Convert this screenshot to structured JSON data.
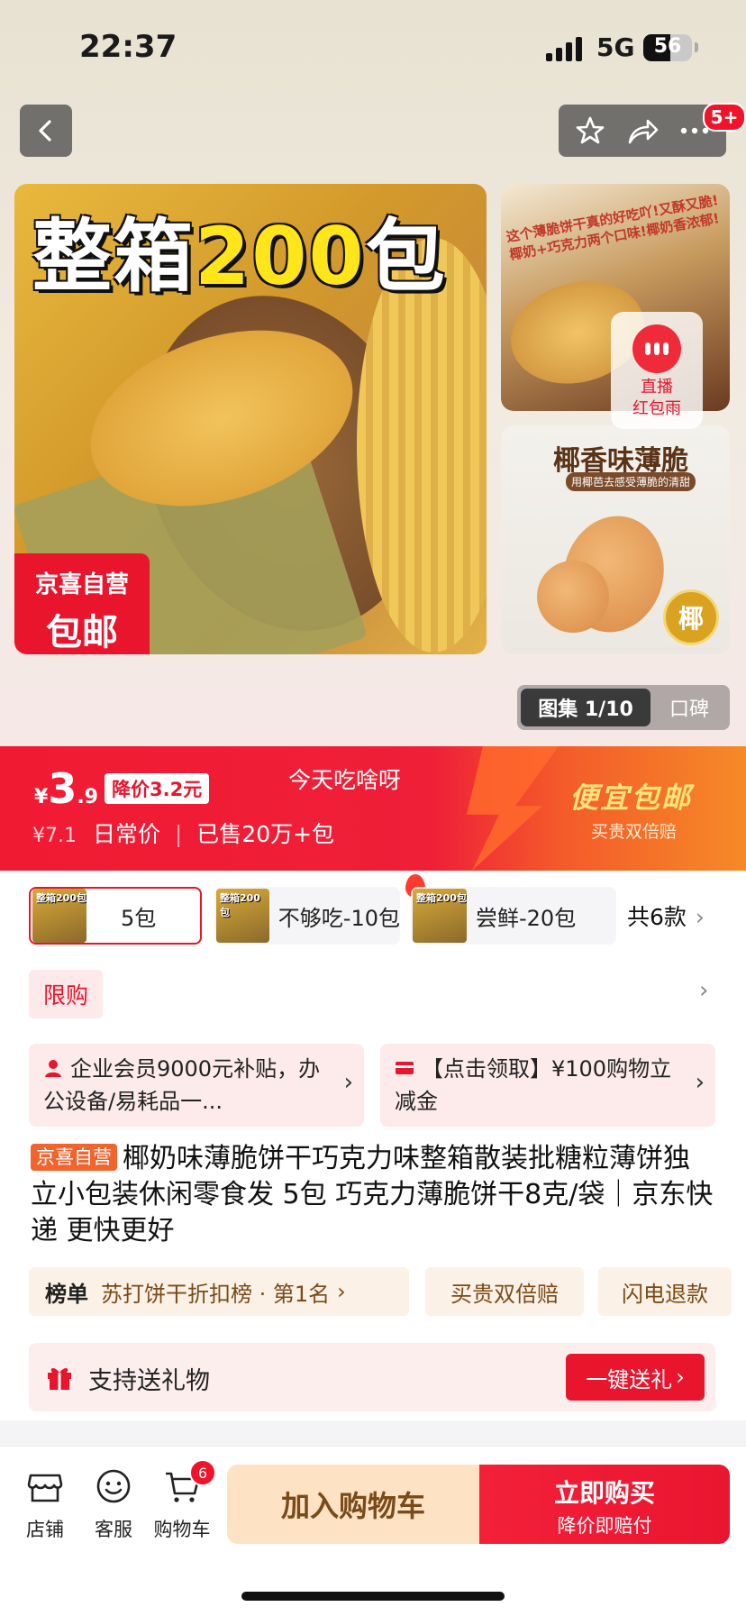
{
  "status": {
    "time": "22:37",
    "network": "5G",
    "battery": "56",
    "battery_level": 0.56
  },
  "header": {
    "back_icon": "chevron-left-icon",
    "actions": [
      "star-icon",
      "share-icon",
      "more-icon"
    ],
    "message_badge": "5+"
  },
  "gallery_images": {
    "main": {
      "headline_pre": "整箱",
      "headline_num": "200",
      "headline_post": "包",
      "corner_line1": "京喜自营",
      "corner_line2": "包邮"
    },
    "side1": {
      "caption": "这个薄脆饼干真的好吃吖!又酥又脆!椰奶+巧克力两个口味!椰奶香浓郁!"
    },
    "side2": {
      "title": "椰香味薄脆",
      "subtitle": "用椰芭去感受薄脆的清甜",
      "seal": "椰"
    },
    "live": {
      "line1": "直播",
      "line2": "红包雨"
    },
    "counter": "图集 1/10",
    "reviews_tab": "口碑"
  },
  "price_banner": {
    "currency": "¥",
    "price_int": "3",
    "price_dec": ".9",
    "drop_tag": "降价3.2元",
    "note": "今天吃啥呀",
    "original_price": "¥7.1",
    "original_label": "日常价",
    "sold": "已售20万+包",
    "shipping_title": "便宜包邮",
    "shipping_sub": "买贵双倍赔"
  },
  "variants": {
    "items": [
      {
        "label": "5包",
        "thumb_text": "整箱200包",
        "selected": true
      },
      {
        "label": "不够吃-10包",
        "thumb_text": "整箱200包",
        "selected": false
      },
      {
        "label": "尝鲜-20包",
        "thumb_text": "整箱200包",
        "selected": false
      }
    ],
    "count": "共6款"
  },
  "limit_label": "限购",
  "promos": [
    {
      "text": "企业会员9000元补贴，办公设备/易耗品一...",
      "icon": "person-icon"
    },
    {
      "text": "【点击领取】¥100购物立减金",
      "icon": "card-icon"
    }
  ],
  "product": {
    "tag": "京喜自营",
    "title": "椰奶味薄脆饼干巧克力味整箱散装批糖粒薄饼独立小包装休闲零食发 5包 巧克力薄脆饼干8克/袋｜京东快递 更快更好"
  },
  "chips": {
    "rank_label": "榜单",
    "rank_text": "苏打饼干折扣榜 · 第1名",
    "guarantee1": "买贵双倍赔",
    "guarantee2": "闪电退款"
  },
  "gift": {
    "label": "支持送礼物",
    "button": "一键送礼"
  },
  "bottom_bar": {
    "store": "店铺",
    "service": "客服",
    "cart": "购物车",
    "cart_badge": "6",
    "add_to_cart": "加入购物车",
    "buy_now": "立即购买",
    "buy_now_sub": "降价即赔付"
  },
  "colors": {
    "brand_red": "#e8152d",
    "orange": "#f58a27",
    "gold": "#ffe27a"
  }
}
